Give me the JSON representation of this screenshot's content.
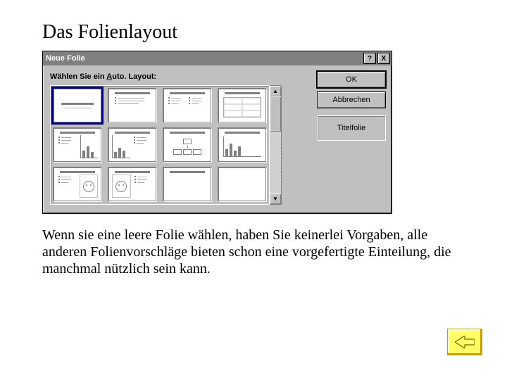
{
  "heading": "Das Folienlayout",
  "dialog": {
    "title": "Neue Folie",
    "help_glyph": "?",
    "close_glyph": "X",
    "prompt_pre": "Wählen Sie ein ",
    "prompt_ul": "A",
    "prompt_post": "uto. Layout:",
    "ok": "OK",
    "cancel": "Abbrechen",
    "selection_name": "Titelfolie",
    "scroll_up": "▲",
    "scroll_down": "▼",
    "selected_index": 0,
    "layouts": [
      "title-slide",
      "bulleted-list",
      "two-column-text",
      "table",
      "text-and-chart",
      "chart-and-text",
      "org-chart",
      "chart",
      "text-and-clipart",
      "clipart-and-text",
      "title-only",
      "blank"
    ]
  },
  "body_text": "Wenn sie eine leere Folie wählen, haben Sie keinerlei Vorgaben, alle anderen Folienvorschläge bieten schon eine vorgefertigte Einteilung, die manchmal nützlich sein kann."
}
